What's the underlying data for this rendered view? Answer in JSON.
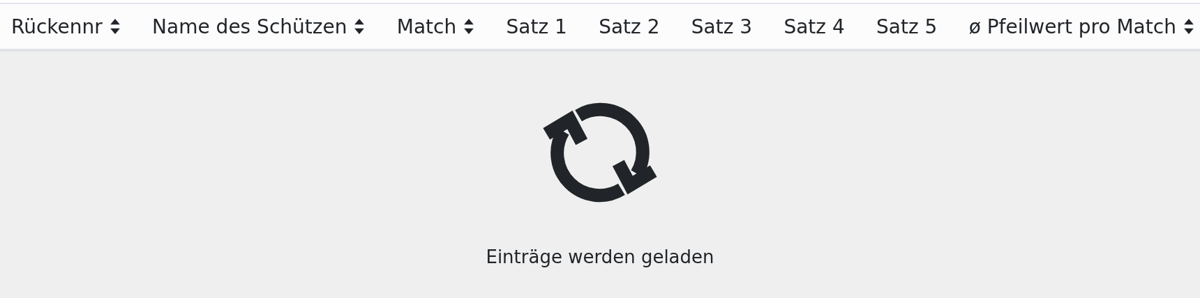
{
  "table": {
    "columns": [
      {
        "label": "Rückennr",
        "sortable": true
      },
      {
        "label": "Name des Schützen",
        "sortable": true
      },
      {
        "label": "Match",
        "sortable": true
      },
      {
        "label": "Satz 1",
        "sortable": false
      },
      {
        "label": "Satz 2",
        "sortable": false
      },
      {
        "label": "Satz 3",
        "sortable": false
      },
      {
        "label": "Satz 4",
        "sortable": false
      },
      {
        "label": "Satz 5",
        "sortable": false
      },
      {
        "label": "ø Pfeilwert pro Match",
        "sortable": true
      }
    ],
    "loading": {
      "message": "Einträge werden geladen"
    }
  }
}
